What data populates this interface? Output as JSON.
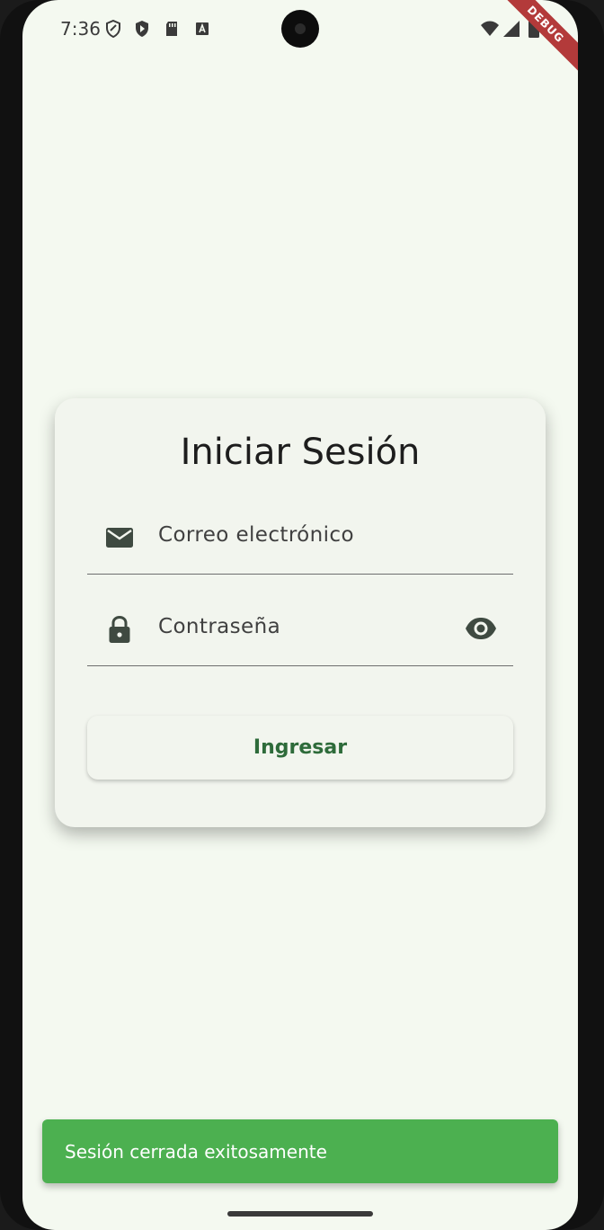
{
  "status_bar": {
    "time": "7:36",
    "icons": [
      "shield-icon",
      "play-protect-icon",
      "sd-card-icon",
      "font-a-icon",
      "wifi-icon",
      "signal-icon",
      "battery-icon"
    ]
  },
  "debug_banner": "DEBUG",
  "login": {
    "title": "Iniciar Sesión",
    "email_label": "Correo electrónico",
    "password_label": "Contraseña",
    "submit_label": "Ingresar"
  },
  "snackbar": {
    "message": "Sesión cerrada exitosamente"
  },
  "colors": {
    "background": "#f4f9f0",
    "card": "#f2f5ee",
    "accent_text": "#2e6b3a",
    "snackbar": "#4cb050",
    "debug_ribbon": "#b33a3a"
  }
}
